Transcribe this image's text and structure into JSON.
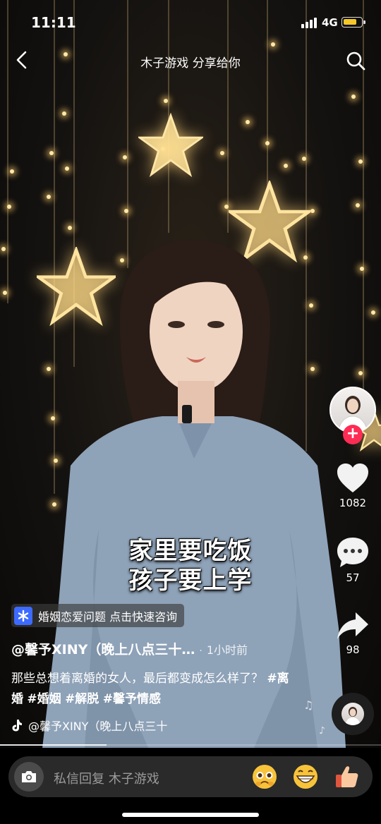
{
  "status": {
    "time": "11:11",
    "network": "4G"
  },
  "nav": {
    "title": "木子游戏 分享给你"
  },
  "rail": {
    "likes": "1082",
    "comments": "57",
    "shares": "98"
  },
  "caption": {
    "line1": "家里要吃饭",
    "line2": "孩子要上学"
  },
  "promo": {
    "text": "婚姻恋爱问题 点击快速咨询"
  },
  "post": {
    "author": "@馨予XINY（晚上八点三十…",
    "separator": "·",
    "time_ago": "1小时前",
    "desc": "那些总想着离婚的女人，最后都变成怎么样了？",
    "tags": [
      "#离婚",
      "#婚姻",
      "#解脱",
      "#馨予情感"
    ],
    "music": "@馨予XINY（晚上八点三十"
  },
  "progress": {
    "fraction": 0.28
  },
  "bottom": {
    "placeholder": "私信回复 木子游戏"
  },
  "icons": [
    "back-icon",
    "search-icon",
    "heart-icon",
    "comment-icon",
    "share-icon",
    "camera-icon",
    "music-note-icon",
    "tiktok-icon"
  ],
  "colors": {
    "accent": "#fe2c55",
    "promo_icon": "#3d6bff",
    "battery": "#f3c72a"
  }
}
